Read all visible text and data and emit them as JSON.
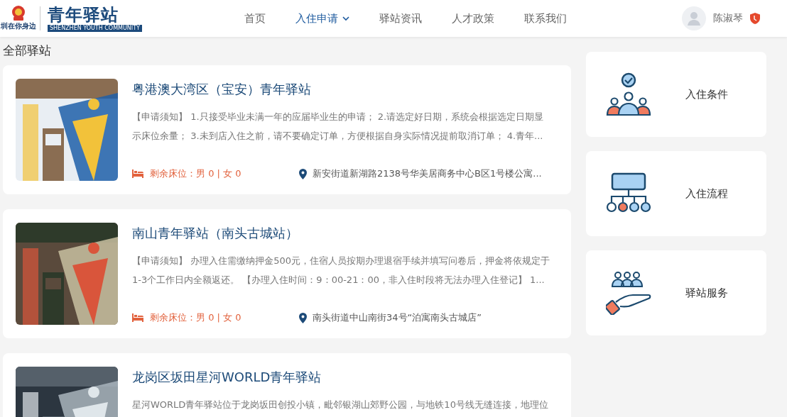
{
  "header": {
    "logo": {
      "slogan": "圳在你身边",
      "title": "青年驿站",
      "subtitle": "SHENZHEN YOUTH COMMUNITY"
    },
    "nav": [
      {
        "label": "首页",
        "selected": false,
        "has_menu": false
      },
      {
        "label": "入住申请",
        "selected": true,
        "has_menu": true
      },
      {
        "label": "驿站资讯",
        "selected": false,
        "has_menu": false
      },
      {
        "label": "人才政策",
        "selected": false,
        "has_menu": false
      },
      {
        "label": "联系我们",
        "selected": false,
        "has_menu": false
      }
    ],
    "user": {
      "name": "陈淑琴"
    }
  },
  "section_title": "全部驿站",
  "stations": [
    {
      "title": "粤港澳大湾区（宝安）青年驿站",
      "notice": "【申请须知】 1.只接受毕业未满一年的应届毕业生的申请； 2.请选定好日期，系统会根据选定日期显示床位余量； 3.未到店入住之前，请不要确定订单，方便根据自身实际情况提前取消订单； 4.青年...",
      "beds": "剩余床位：男 0 | 女 0",
      "address": "新安街道新湖路2138号华美居商务中心B区1号楼公寓..."
    },
    {
      "title": "南山青年驿站（南头古城站）",
      "notice": "【申请须知】 办理入住需缴纳押金500元，住宿人员按期办理退宿手续并填写问卷后，押金将依规定于1-3个工作日内全额返还。 【办理入住时间：9：00-21：00，非入住时段将无法办理入住登记】 1...",
      "beds": "剩余床位：男 0 | 女 0",
      "address": "南头街道中山南街34号“泊寓南头古城店”"
    },
    {
      "title": "龙岗区坂田星河WORLD青年驿站",
      "notice": "星河WORLD青年驿站位于龙岗坂田创投小镇，毗邻银湖山郊野公园，与地铁10号线无缝连接，地理位"
    }
  ],
  "side_links": [
    {
      "label": "入住条件",
      "kind": "people"
    },
    {
      "label": "入住流程",
      "kind": "flow"
    },
    {
      "label": "驿站服务",
      "kind": "service"
    }
  ]
}
